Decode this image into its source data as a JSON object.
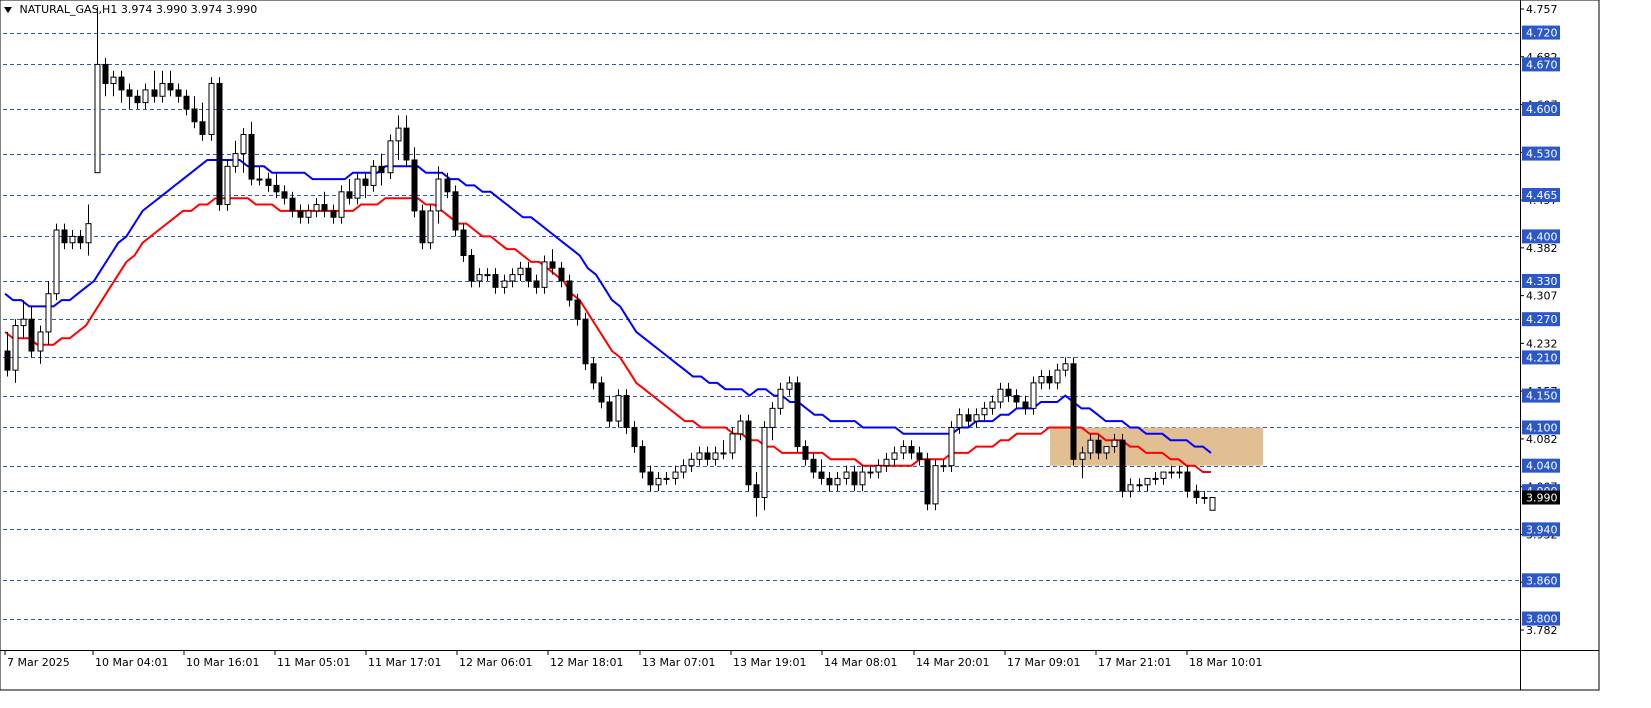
{
  "header": {
    "symbol_label": "NATURAL_GAS,H1",
    "ohlc_label": "3.974 3.990 3.974 3.990"
  },
  "chart_data": {
    "type": "candlestick",
    "symbol": "NATURAL_GAS",
    "timeframe": "H1",
    "ylim": [
      3.782,
      4.757
    ],
    "y_tick_labels": [
      "4.757",
      "4.682",
      "4.607",
      "4.532",
      "4.457",
      "4.382",
      "4.307",
      "4.232",
      "4.157",
      "4.082",
      "4.007",
      "3.932",
      "3.857",
      "3.782"
    ],
    "y_ticks": [
      4.757,
      4.682,
      4.607,
      4.532,
      4.457,
      4.382,
      4.307,
      4.232,
      4.157,
      4.082,
      4.007,
      3.932,
      3.857,
      3.782
    ],
    "x_tick_labels": [
      "7 Mar 2025",
      "10 Mar 04:01",
      "10 Mar 16:01",
      "11 Mar 05:01",
      "11 Mar 17:01",
      "12 Mar 06:01",
      "12 Mar 18:01",
      "13 Mar 07:01",
      "13 Mar 19:01",
      "14 Mar 08:01",
      "14 Mar 20:01",
      "17 Mar 09:01",
      "17 Mar 21:01",
      "18 Mar 10:01"
    ],
    "levels": [
      4.72,
      4.67,
      4.6,
      4.53,
      4.465,
      4.4,
      4.33,
      4.27,
      4.21,
      4.15,
      4.1,
      4.04,
      4.0,
      3.94,
      3.86,
      3.8
    ],
    "level_labels": [
      "4.720",
      "4.670",
      "4.600",
      "4.530",
      "4.465",
      "4.400",
      "4.330",
      "4.270",
      "4.210",
      "4.150",
      "4.100",
      "4.040",
      "4.000",
      "3.940",
      "3.860",
      "3.800"
    ],
    "current_price": 3.99,
    "current_price_label": "3.990",
    "zone": {
      "top": 4.1,
      "bottom": 4.04
    },
    "ma_slow": [
      4.31,
      4.3,
      4.3,
      4.29,
      4.29,
      4.29,
      4.29,
      4.3,
      4.3,
      4.31,
      4.32,
      4.33,
      4.35,
      4.37,
      4.39,
      4.4,
      4.42,
      4.44,
      4.45,
      4.46,
      4.47,
      4.48,
      4.49,
      4.5,
      4.51,
      4.52,
      4.52,
      4.52,
      4.52,
      4.52,
      4.51,
      4.51,
      4.51,
      4.5,
      4.5,
      4.5,
      4.5,
      4.5,
      4.49,
      4.49,
      4.49,
      4.49,
      4.49,
      4.5,
      4.5,
      4.5,
      4.5,
      4.51,
      4.51,
      4.51,
      4.51,
      4.51,
      4.5,
      4.5,
      4.5,
      4.49,
      4.49,
      4.48,
      4.48,
      4.47,
      4.47,
      4.46,
      4.45,
      4.44,
      4.43,
      4.43,
      4.42,
      4.41,
      4.4,
      4.39,
      4.38,
      4.37,
      4.35,
      4.34,
      4.32,
      4.3,
      4.29,
      4.27,
      4.25,
      4.24,
      4.23,
      4.22,
      4.21,
      4.2,
      4.19,
      4.18,
      4.18,
      4.17,
      4.17,
      4.16,
      4.16,
      4.16,
      4.15,
      4.16,
      4.16,
      4.15,
      4.15,
      4.14,
      4.14,
      4.13,
      4.12,
      4.12,
      4.11,
      4.11,
      4.11,
      4.11,
      4.1,
      4.1,
      4.1,
      4.1,
      4.1,
      4.09,
      4.09,
      4.09,
      4.09,
      4.09,
      4.09,
      4.09,
      4.1,
      4.1,
      4.11,
      4.11,
      4.11,
      4.12,
      4.12,
      4.13,
      4.13,
      4.13,
      4.14,
      4.14,
      4.14,
      4.15,
      4.14,
      4.13,
      4.13,
      4.12,
      4.11,
      4.11,
      4.11,
      4.1,
      4.1,
      4.09,
      4.09,
      4.09,
      4.08,
      4.08,
      4.08,
      4.07,
      4.07,
      4.06
    ],
    "ma_fast": [
      4.25,
      4.24,
      4.24,
      4.24,
      4.23,
      4.23,
      4.23,
      4.24,
      4.24,
      4.25,
      4.26,
      4.28,
      4.3,
      4.32,
      4.34,
      4.36,
      4.37,
      4.39,
      4.4,
      4.41,
      4.42,
      4.43,
      4.44,
      4.44,
      4.45,
      4.45,
      4.46,
      4.46,
      4.46,
      4.46,
      4.46,
      4.45,
      4.45,
      4.45,
      4.44,
      4.44,
      4.44,
      4.44,
      4.44,
      4.44,
      4.44,
      4.44,
      4.44,
      4.44,
      4.45,
      4.45,
      4.45,
      4.46,
      4.46,
      4.46,
      4.46,
      4.46,
      4.45,
      4.45,
      4.44,
      4.43,
      4.42,
      4.42,
      4.41,
      4.4,
      4.4,
      4.39,
      4.38,
      4.38,
      4.37,
      4.36,
      4.36,
      4.35,
      4.34,
      4.33,
      4.31,
      4.3,
      4.28,
      4.26,
      4.24,
      4.22,
      4.21,
      4.19,
      4.17,
      4.16,
      4.15,
      4.14,
      4.13,
      4.12,
      4.11,
      4.11,
      4.1,
      4.1,
      4.1,
      4.1,
      4.09,
      4.09,
      4.08,
      4.08,
      4.07,
      4.07,
      4.06,
      4.06,
      4.06,
      4.06,
      4.06,
      4.06,
      4.05,
      4.05,
      4.05,
      4.05,
      4.04,
      4.04,
      4.04,
      4.04,
      4.04,
      4.04,
      4.04,
      4.05,
      4.05,
      4.05,
      4.05,
      4.06,
      4.06,
      4.06,
      4.07,
      4.07,
      4.07,
      4.08,
      4.08,
      4.09,
      4.09,
      4.09,
      4.09,
      4.1,
      4.1,
      4.1,
      4.1,
      4.1,
      4.09,
      4.09,
      4.08,
      4.08,
      4.08,
      4.07,
      4.07,
      4.06,
      4.06,
      4.06,
      4.05,
      4.05,
      4.04,
      4.04,
      4.03,
      4.03
    ],
    "candles": [
      [
        4.22,
        4.25,
        4.18,
        4.19
      ],
      [
        4.19,
        4.27,
        4.17,
        4.26
      ],
      [
        4.26,
        4.3,
        4.24,
        4.27
      ],
      [
        4.27,
        4.29,
        4.21,
        4.22
      ],
      [
        4.22,
        4.26,
        4.2,
        4.25
      ],
      [
        4.25,
        4.33,
        4.23,
        4.31
      ],
      [
        4.31,
        4.42,
        4.3,
        4.41
      ],
      [
        4.41,
        4.42,
        4.38,
        4.39
      ],
      [
        4.39,
        4.41,
        4.38,
        4.4
      ],
      [
        4.4,
        4.41,
        4.38,
        4.39
      ],
      [
        4.39,
        4.45,
        4.37,
        4.42
      ],
      [
        4.5,
        4.76,
        4.51,
        4.67
      ],
      [
        4.67,
        4.68,
        4.62,
        4.64
      ],
      [
        4.64,
        4.66,
        4.62,
        4.65
      ],
      [
        4.65,
        4.66,
        4.61,
        4.63
      ],
      [
        4.63,
        4.64,
        4.6,
        4.62
      ],
      [
        4.62,
        4.63,
        4.6,
        4.61
      ],
      [
        4.61,
        4.64,
        4.6,
        4.63
      ],
      [
        4.63,
        4.66,
        4.61,
        4.62
      ],
      [
        4.62,
        4.66,
        4.61,
        4.64
      ],
      [
        4.64,
        4.66,
        4.62,
        4.63
      ],
      [
        4.63,
        4.64,
        4.61,
        4.62
      ],
      [
        4.62,
        4.63,
        4.59,
        4.6
      ],
      [
        4.6,
        4.62,
        4.57,
        4.58
      ],
      [
        4.58,
        4.61,
        4.55,
        4.56
      ],
      [
        4.56,
        4.65,
        4.55,
        4.64
      ],
      [
        4.64,
        4.65,
        4.44,
        4.45
      ],
      [
        4.45,
        4.52,
        4.44,
        4.51
      ],
      [
        4.51,
        4.55,
        4.5,
        4.53
      ],
      [
        4.53,
        4.57,
        4.5,
        4.56
      ],
      [
        4.56,
        4.58,
        4.48,
        4.49
      ],
      [
        4.49,
        4.51,
        4.48,
        4.49
      ],
      [
        4.49,
        4.5,
        4.47,
        4.48
      ],
      [
        4.48,
        4.5,
        4.46,
        4.47
      ],
      [
        4.47,
        4.48,
        4.45,
        4.46
      ],
      [
        4.46,
        4.47,
        4.43,
        4.44
      ],
      [
        4.44,
        4.45,
        4.42,
        4.43
      ],
      [
        4.43,
        4.45,
        4.42,
        4.44
      ],
      [
        4.44,
        4.46,
        4.43,
        4.45
      ],
      [
        4.45,
        4.47,
        4.43,
        4.44
      ],
      [
        4.44,
        4.45,
        4.42,
        4.43
      ],
      [
        4.43,
        4.48,
        4.42,
        4.47
      ],
      [
        4.47,
        4.49,
        4.45,
        4.46
      ],
      [
        4.46,
        4.5,
        4.45,
        4.49
      ],
      [
        4.49,
        4.5,
        4.46,
        4.48
      ],
      [
        4.48,
        4.52,
        4.47,
        4.51
      ],
      [
        4.51,
        4.53,
        4.48,
        4.5
      ],
      [
        4.5,
        4.56,
        4.49,
        4.55
      ],
      [
        4.55,
        4.59,
        4.52,
        4.57
      ],
      [
        4.57,
        4.59,
        4.51,
        4.52
      ],
      [
        4.52,
        4.54,
        4.43,
        4.44
      ],
      [
        4.44,
        4.45,
        4.38,
        4.39
      ],
      [
        4.39,
        4.45,
        4.38,
        4.44
      ],
      [
        4.44,
        4.51,
        4.42,
        4.49
      ],
      [
        4.49,
        4.5,
        4.46,
        4.47
      ],
      [
        4.47,
        4.48,
        4.4,
        4.41
      ],
      [
        4.41,
        4.42,
        4.36,
        4.37
      ],
      [
        4.37,
        4.38,
        4.32,
        4.33
      ],
      [
        4.33,
        4.35,
        4.32,
        4.34
      ],
      [
        4.34,
        4.35,
        4.33,
        4.34
      ],
      [
        4.34,
        4.35,
        4.31,
        4.32
      ],
      [
        4.32,
        4.34,
        4.31,
        4.33
      ],
      [
        4.33,
        4.35,
        4.32,
        4.34
      ],
      [
        4.34,
        4.36,
        4.33,
        4.35
      ],
      [
        4.35,
        4.36,
        4.32,
        4.33
      ],
      [
        4.33,
        4.34,
        4.31,
        4.32
      ],
      [
        4.32,
        4.37,
        4.31,
        4.36
      ],
      [
        4.36,
        4.38,
        4.34,
        4.35
      ],
      [
        4.35,
        4.36,
        4.32,
        4.33
      ],
      [
        4.33,
        4.34,
        4.29,
        4.3
      ],
      [
        4.3,
        4.31,
        4.26,
        4.27
      ],
      [
        4.27,
        4.28,
        4.19,
        4.2
      ],
      [
        4.2,
        4.21,
        4.16,
        4.17
      ],
      [
        4.17,
        4.18,
        4.13,
        4.14
      ],
      [
        4.14,
        4.15,
        4.1,
        4.11
      ],
      [
        4.11,
        4.16,
        4.1,
        4.15
      ],
      [
        4.15,
        4.16,
        4.09,
        4.1
      ],
      [
        4.1,
        4.11,
        4.06,
        4.07
      ],
      [
        4.07,
        4.08,
        4.02,
        4.03
      ],
      [
        4.03,
        4.04,
        4.0,
        4.01
      ],
      [
        4.01,
        4.03,
        4.0,
        4.02
      ],
      [
        4.02,
        4.03,
        4.01,
        4.02
      ],
      [
        4.02,
        4.04,
        4.01,
        4.03
      ],
      [
        4.03,
        4.05,
        4.02,
        4.04
      ],
      [
        4.04,
        4.06,
        4.03,
        4.05
      ],
      [
        4.05,
        4.07,
        4.04,
        4.06
      ],
      [
        4.06,
        4.07,
        4.04,
        4.05
      ],
      [
        4.05,
        4.07,
        4.04,
        4.06
      ],
      [
        4.06,
        4.08,
        4.05,
        4.06
      ],
      [
        4.06,
        4.1,
        4.05,
        4.09
      ],
      [
        4.09,
        4.12,
        4.08,
        4.11
      ],
      [
        4.11,
        4.12,
        4.0,
        4.01
      ],
      [
        4.01,
        4.03,
        3.96,
        3.99
      ],
      [
        3.99,
        4.11,
        3.97,
        4.1
      ],
      [
        4.1,
        4.14,
        4.08,
        4.13
      ],
      [
        4.13,
        4.17,
        4.12,
        4.16
      ],
      [
        4.16,
        4.18,
        4.15,
        4.17
      ],
      [
        4.17,
        4.18,
        4.06,
        4.07
      ],
      [
        4.07,
        4.08,
        4.04,
        4.05
      ],
      [
        4.05,
        4.06,
        4.02,
        4.03
      ],
      [
        4.03,
        4.05,
        4.01,
        4.02
      ],
      [
        4.02,
        4.03,
        4.0,
        4.01
      ],
      [
        4.01,
        4.03,
        4.0,
        4.02
      ],
      [
        4.02,
        4.04,
        4.01,
        4.03
      ],
      [
        4.03,
        4.04,
        4.0,
        4.01
      ],
      [
        4.01,
        4.04,
        4.0,
        4.03
      ],
      [
        4.03,
        4.04,
        4.02,
        4.03
      ],
      [
        4.03,
        4.05,
        4.02,
        4.04
      ],
      [
        4.04,
        4.06,
        4.03,
        4.05
      ],
      [
        4.05,
        4.07,
        4.04,
        4.06
      ],
      [
        4.06,
        4.08,
        4.05,
        4.07
      ],
      [
        4.07,
        4.08,
        4.05,
        4.06
      ],
      [
        4.06,
        4.07,
        4.04,
        4.05
      ],
      [
        4.05,
        4.06,
        3.97,
        3.98
      ],
      [
        3.98,
        4.05,
        3.97,
        4.04
      ],
      [
        4.04,
        4.05,
        4.03,
        4.04
      ],
      [
        4.04,
        4.11,
        4.03,
        4.1
      ],
      [
        4.1,
        4.13,
        4.09,
        4.12
      ],
      [
        4.12,
        4.13,
        4.1,
        4.11
      ],
      [
        4.11,
        4.13,
        4.1,
        4.12
      ],
      [
        4.12,
        4.14,
        4.11,
        4.13
      ],
      [
        4.13,
        4.15,
        4.12,
        4.14
      ],
      [
        4.14,
        4.17,
        4.13,
        4.16
      ],
      [
        4.16,
        4.17,
        4.14,
        4.15
      ],
      [
        4.15,
        4.16,
        4.13,
        4.14
      ],
      [
        4.14,
        4.15,
        4.12,
        4.13
      ],
      [
        4.13,
        4.18,
        4.12,
        4.17
      ],
      [
        4.17,
        4.19,
        4.16,
        4.18
      ],
      [
        4.18,
        4.19,
        4.16,
        4.17
      ],
      [
        4.17,
        4.2,
        4.16,
        4.19
      ],
      [
        4.19,
        4.21,
        4.18,
        4.2
      ],
      [
        4.2,
        4.21,
        4.04,
        4.05
      ],
      [
        4.05,
        4.07,
        4.02,
        4.06
      ],
      [
        4.06,
        4.09,
        4.05,
        4.08
      ],
      [
        4.08,
        4.09,
        4.05,
        4.06
      ],
      [
        4.06,
        4.07,
        4.05,
        4.07
      ],
      [
        4.07,
        4.09,
        4.06,
        4.08
      ],
      [
        4.08,
        4.09,
        3.99,
        4.0
      ],
      [
        4.0,
        4.02,
        3.99,
        4.01
      ],
      [
        4.01,
        4.02,
        4.0,
        4.01
      ],
      [
        4.01,
        4.02,
        4.0,
        4.02
      ],
      [
        4.02,
        4.03,
        4.01,
        4.02
      ],
      [
        4.02,
        4.03,
        4.01,
        4.03
      ],
      [
        4.03,
        4.04,
        4.02,
        4.03
      ],
      [
        4.03,
        4.04,
        4.02,
        4.03
      ],
      [
        4.03,
        4.04,
        3.99,
        4.0
      ],
      [
        4.0,
        4.01,
        3.98,
        3.99
      ],
      [
        3.99,
        4.0,
        3.98,
        3.99
      ],
      [
        3.97,
        3.99,
        3.97,
        3.99
      ]
    ]
  }
}
